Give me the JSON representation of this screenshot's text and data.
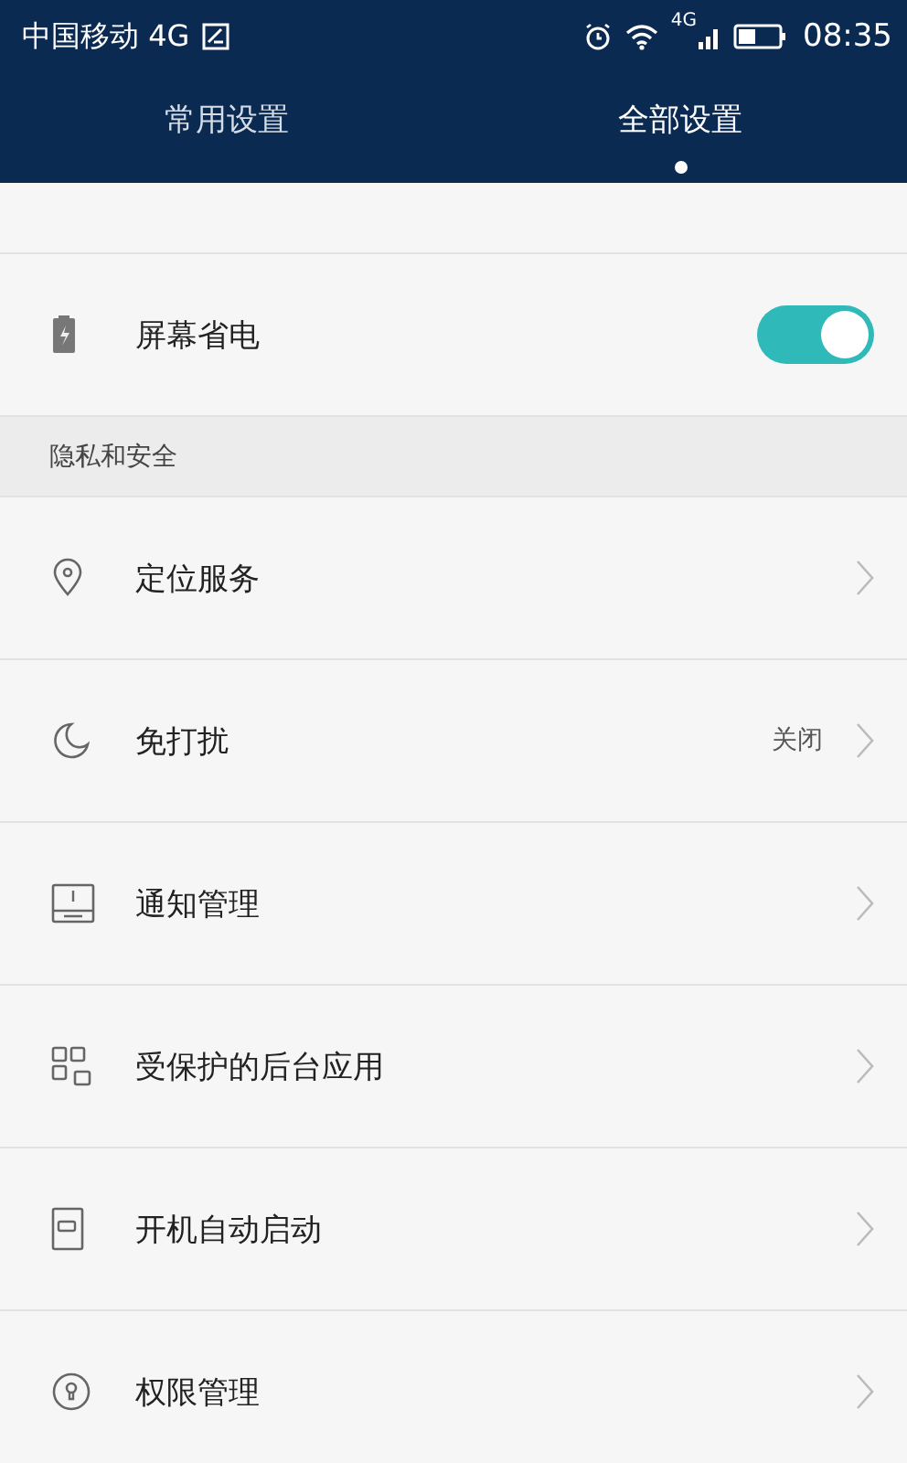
{
  "status_bar": {
    "carrier": "中国移动 4G",
    "time": "08:35",
    "signal_label": "4G"
  },
  "tabs": [
    {
      "label": "常用设置",
      "selected": false
    },
    {
      "label": "全部设置",
      "selected": true
    }
  ],
  "items": [
    {
      "kind": "toggle",
      "label": "屏幕省电",
      "on": true
    },
    {
      "kind": "section",
      "label": "隐私和安全"
    },
    {
      "kind": "link",
      "label": "定位服务"
    },
    {
      "kind": "link",
      "label": "免打扰",
      "value": "关闭"
    },
    {
      "kind": "link",
      "label": "通知管理"
    },
    {
      "kind": "link",
      "label": "受保护的后台应用"
    },
    {
      "kind": "link",
      "label": "开机自动启动"
    },
    {
      "kind": "link",
      "label": "权限管理"
    }
  ]
}
